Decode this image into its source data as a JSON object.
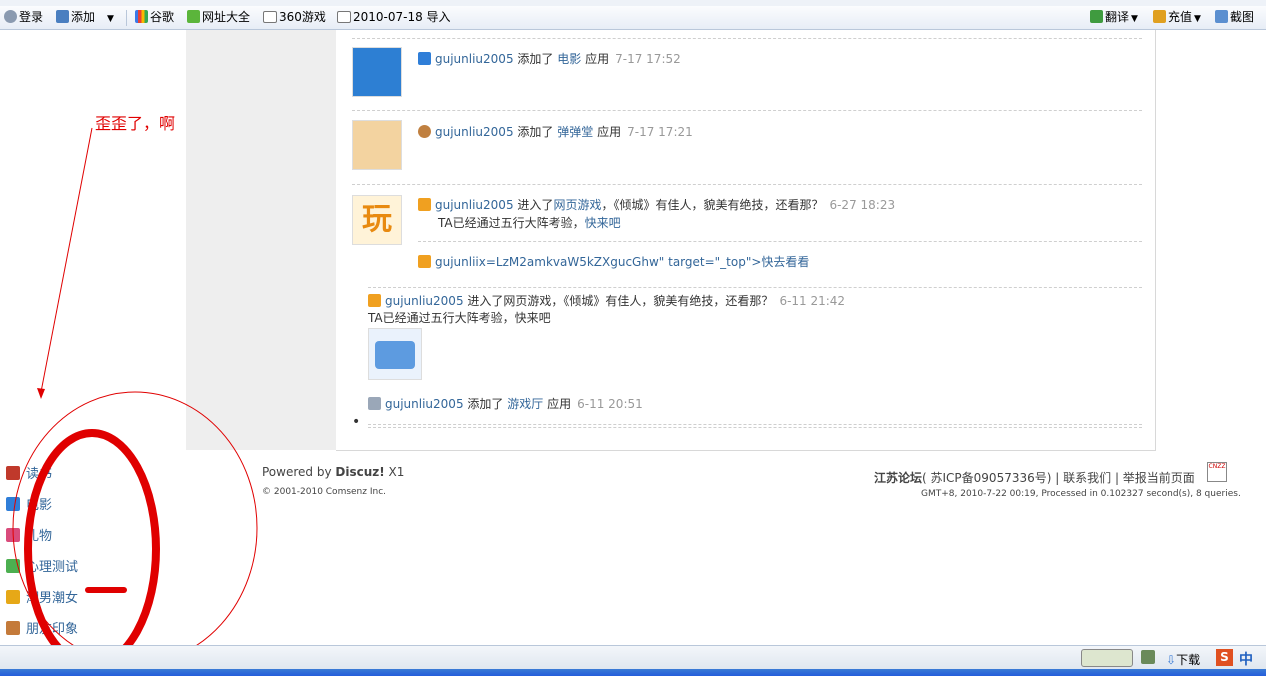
{
  "browser": {
    "toolbar": {
      "login": "登录",
      "add": "添加",
      "google": "谷歌",
      "sites": "网址大全",
      "games": "360游戏",
      "import_folder": "2010-07-18 导入",
      "translate": "翻译",
      "recharge": "充值",
      "screenshot": "截图"
    },
    "status": {
      "download": "下载",
      "ime": "中"
    },
    "colors": {
      "accent": "#336699",
      "annotation": "#e00000"
    }
  },
  "feed": [
    {
      "user": "gujunliu2005",
      "action": "添加了",
      "link": "电影",
      "suffix": "应用",
      "time": "7-17 17:52",
      "icon": "movie-clapper-icon"
    },
    {
      "user": "gujunliu2005",
      "action": "添加了",
      "link": "弹弹堂",
      "suffix": "应用",
      "time": "7-17 17:21",
      "icon": "game-avatar-icon"
    },
    {
      "user": "gujunliu2005",
      "action": "进入了",
      "link": "网页游戏",
      "suffix": "，《倾城》有佳人，貌美有绝技，还看那？",
      "time": "6-27 18:23",
      "line2": "TA已经通过五行大阵考验，",
      "line2_link": "快来吧",
      "icon": "play-icon"
    }
  ],
  "broken_link": "gujunliix=LzM2amkvaW5kZXgucGhw\" target=\"_top\">快去看看",
  "feed_plain": {
    "user": "gujunliu2005",
    "text": "进入了网页游戏，《倾城》有佳人，貌美有绝技，还看那？",
    "time": "6-11 21:42",
    "line2": "TA已经通过五行大阵考验，快来吧"
  },
  "feed_last": {
    "user": "gujunliu2005",
    "action": "添加了",
    "link": "游戏厅",
    "suffix": "应用",
    "time": "6-11 20:51"
  },
  "bullet": "•",
  "footer": {
    "powered": "Powered by ",
    "product": "Discuz!",
    "version": " X1",
    "copyright": "© 2001-2010 Comsenz Inc.",
    "site": "江苏论坛",
    "icp": "( 苏ICP备09057336号)",
    "contact": "联系我们",
    "report": "举报当前页面",
    "stats": "GMT+8, 2010-7-22 00:19, Processed in 0.102327 second(s), 8 queries.",
    "badge": "CNZZ"
  },
  "apps": [
    {
      "label": "读书",
      "icon": "book-icon"
    },
    {
      "label": "电影",
      "icon": "movie-icon"
    },
    {
      "label": "礼物",
      "icon": "gift-icon"
    },
    {
      "label": "心理测试",
      "icon": "flask-icon"
    },
    {
      "label": "潮男潮女",
      "icon": "people-icon"
    },
    {
      "label": "朋友印象",
      "icon": "friend-icon"
    }
  ],
  "annotation": {
    "text": "歪歪了，啊"
  }
}
